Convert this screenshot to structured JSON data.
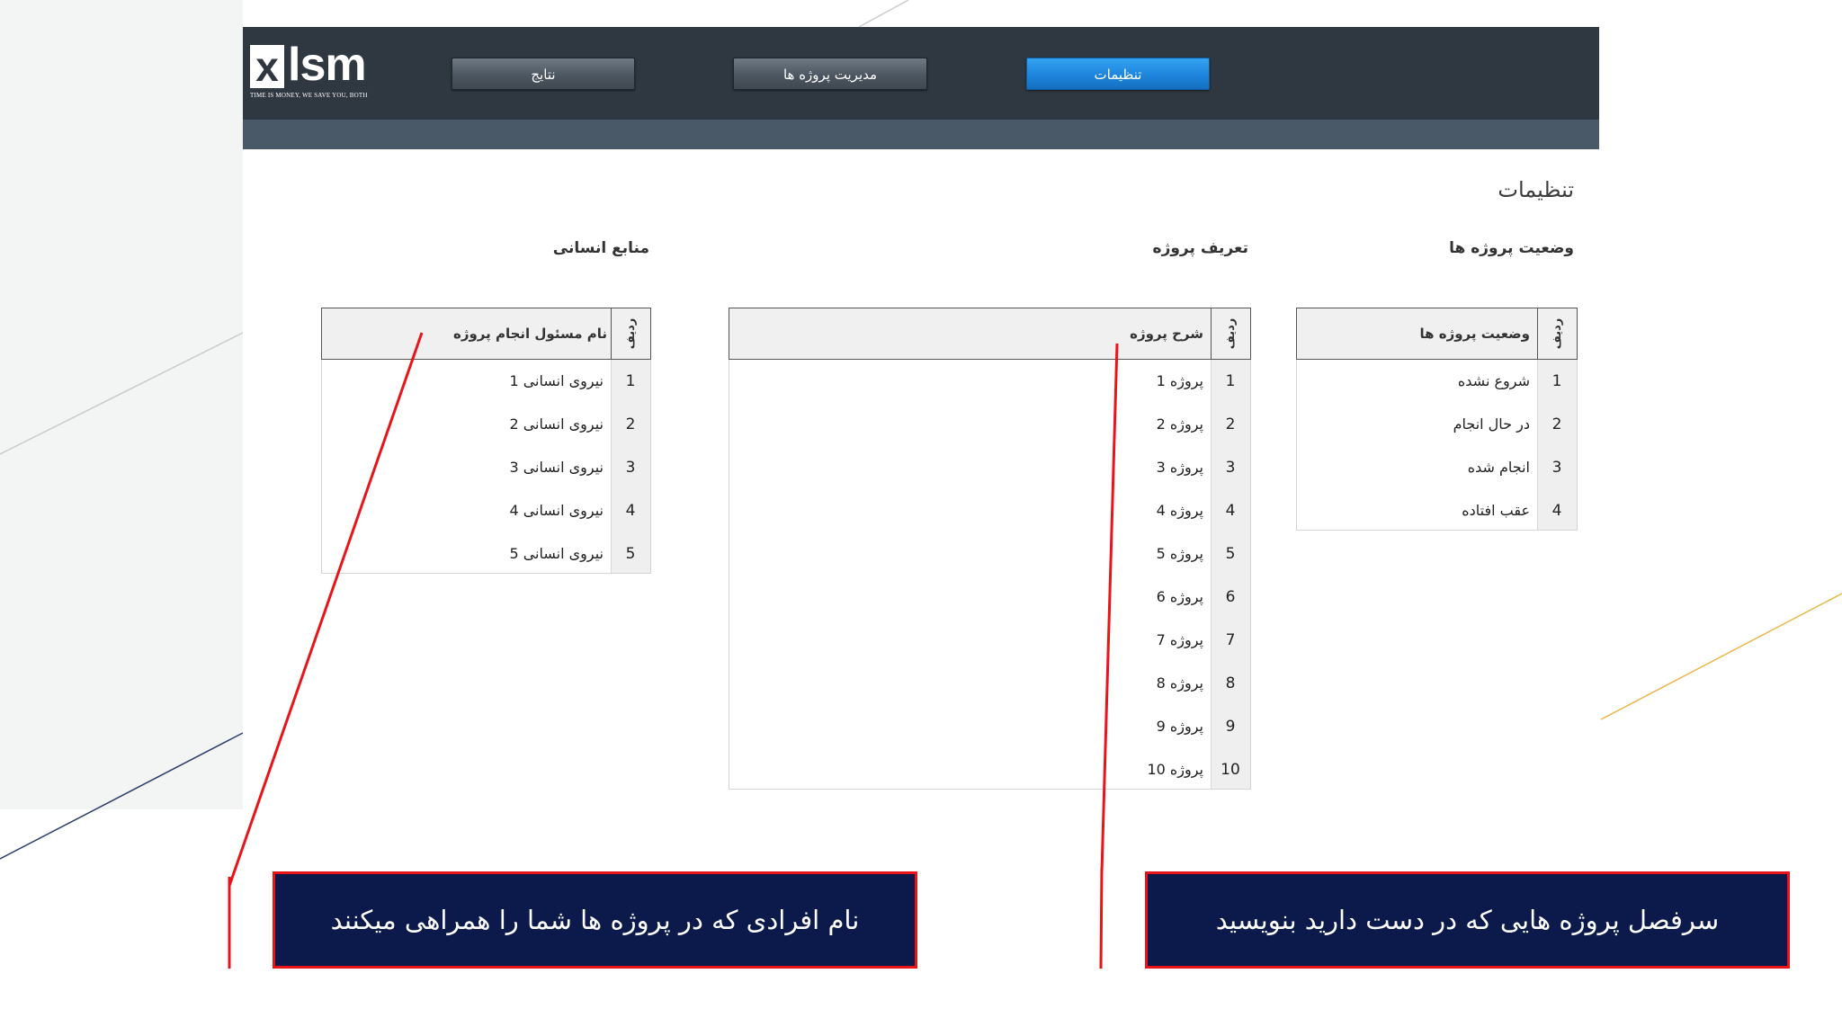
{
  "logo": {
    "letter": "x",
    "word": "lsm",
    "tagline": "TIME IS MONEY, WE SAVE YOU, BOTH"
  },
  "nav": {
    "results": "نتایج",
    "project_management": "مدیریت پروژه ها",
    "settings": "تنظیمات"
  },
  "page_title": "تنظیمات",
  "sections": {
    "project_status": "وضعیت پروژه ها",
    "project_definition": "تعریف پروژه",
    "human_resources": "منابع انسانی"
  },
  "index_header": "ردیف",
  "status_table": {
    "header": "وضعیت پروژه ها",
    "rows": [
      {
        "num": "1",
        "text": "شروع نشده"
      },
      {
        "num": "2",
        "text": "در حال انجام"
      },
      {
        "num": "3",
        "text": "انجام شده"
      },
      {
        "num": "4",
        "text": "عقب افتاده"
      }
    ]
  },
  "projects_table": {
    "header": "شرح پروژه",
    "rows": [
      {
        "num": "1",
        "text": "پروژه 1"
      },
      {
        "num": "2",
        "text": "پروژه 2"
      },
      {
        "num": "3",
        "text": "پروژه 3"
      },
      {
        "num": "4",
        "text": "پروژه 4"
      },
      {
        "num": "5",
        "text": "پروژه 5"
      },
      {
        "num": "6",
        "text": "پروژه 6"
      },
      {
        "num": "7",
        "text": "پروژه 7"
      },
      {
        "num": "8",
        "text": "پروژه 8"
      },
      {
        "num": "9",
        "text": "پروژه 9"
      },
      {
        "num": "10",
        "text": "پروژه 10"
      }
    ]
  },
  "hr_table": {
    "header": "نام مسئول انجام پروژه",
    "rows": [
      {
        "num": "1",
        "text": "نیروی انسانی 1"
      },
      {
        "num": "2",
        "text": "نیروی انسانی 2"
      },
      {
        "num": "3",
        "text": "نیروی انسانی 3"
      },
      {
        "num": "4",
        "text": "نیروی انسانی 4"
      },
      {
        "num": "5",
        "text": "نیروی انسانی 5"
      }
    ]
  },
  "callouts": {
    "projects_hint": "سرفصل پروژه هایی که در دست دارید بنویسید",
    "people_hint": "نام افرادی که در پروژه ها شما را همراهی میکنند"
  },
  "colors": {
    "header_bg": "#2f3740",
    "subbar_bg": "#4a5967",
    "active_button": "#1d85dc",
    "callout_bg": "#0b1a4a",
    "callout_border": "#e8141a",
    "annotation_line": "#e8141a"
  }
}
